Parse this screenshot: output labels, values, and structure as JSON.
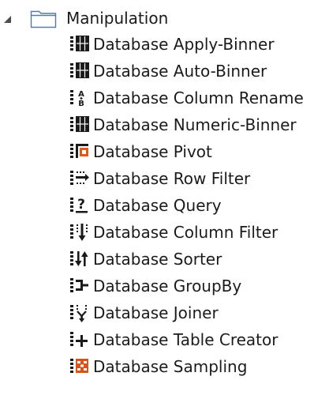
{
  "tree": {
    "folder": {
      "label": "Manipulation",
      "expanded": true,
      "icon": "folder-icon",
      "expander_icon": "expanded-triangle-icon"
    },
    "items": [
      {
        "label": "Database Apply-Binner",
        "icon": "binner-icon"
      },
      {
        "label": "Database Auto-Binner",
        "icon": "binner-icon"
      },
      {
        "label": "Database Column Rename",
        "icon": "rename-icon"
      },
      {
        "label": "Database Numeric-Binner",
        "icon": "binner-icon"
      },
      {
        "label": "Database Pivot",
        "icon": "pivot-icon"
      },
      {
        "label": "Database Row Filter",
        "icon": "row-filter-icon"
      },
      {
        "label": "Database Query",
        "icon": "query-icon"
      },
      {
        "label": "Database Column Filter",
        "icon": "column-filter-icon"
      },
      {
        "label": "Database Sorter",
        "icon": "sorter-icon"
      },
      {
        "label": "Database GroupBy",
        "icon": "groupby-icon"
      },
      {
        "label": "Database Joiner",
        "icon": "joiner-icon"
      },
      {
        "label": "Database Table Creator",
        "icon": "table-creator-icon"
      },
      {
        "label": "Database Sampling",
        "icon": "sampling-icon"
      }
    ],
    "colors": {
      "icon_dark": "#1a1a1a",
      "pivot_accent": "#e2591c",
      "sampling_accent": "#d9541a",
      "folder_stroke": "#5b7aa0",
      "folder_fill": "#ffffff",
      "expander": "#4d4d4d"
    }
  }
}
